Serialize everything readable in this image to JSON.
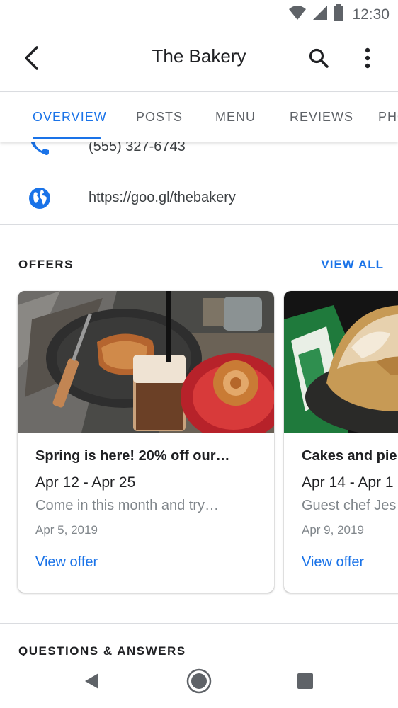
{
  "status_bar": {
    "time": "12:30"
  },
  "app_bar": {
    "title": "The Bakery"
  },
  "tabs": [
    {
      "label": "OVERVIEW"
    },
    {
      "label": "POSTS"
    },
    {
      "label": "MENU"
    },
    {
      "label": "REVIEWS"
    },
    {
      "label": "PHO"
    }
  ],
  "contact": {
    "phone": "(555) 327-6743",
    "website": "https://goo.gl/thebakery"
  },
  "offers": {
    "heading": "OFFERS",
    "view_all": "VIEW ALL",
    "cards": [
      {
        "title": "Spring is here! 20% off our…",
        "dates": "Apr 12 - Apr 25",
        "description": "Come in this month and try…",
        "posted": "Apr 5, 2019",
        "link": "View offer"
      },
      {
        "title": "Cakes and pie",
        "dates": "Apr 14 - Apr 1",
        "description": "Guest chef Jes",
        "posted": "Apr 9, 2019",
        "link": "View offer"
      }
    ]
  },
  "qa": {
    "heading": "QUESTIONS & ANSWERS"
  },
  "colors": {
    "accent": "#1a73e8",
    "text_primary": "#202124",
    "text_secondary": "#80868b",
    "divider": "#dadce0"
  }
}
